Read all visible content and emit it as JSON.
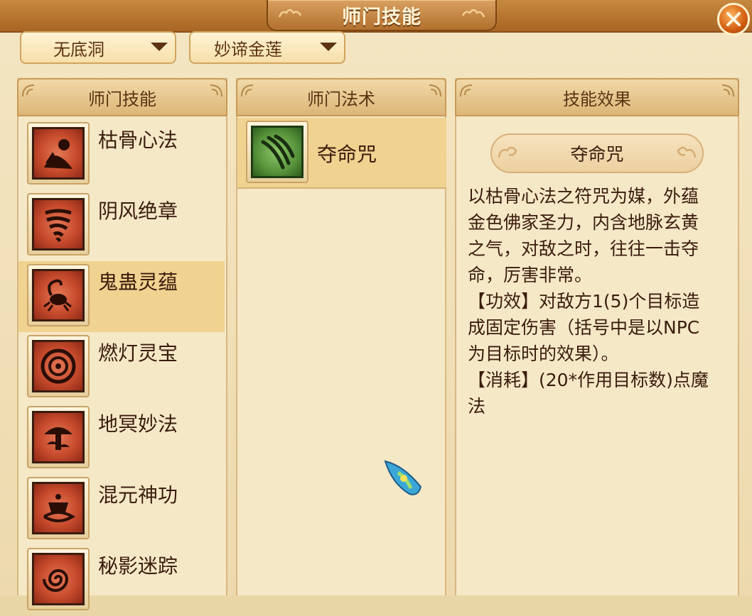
{
  "window": {
    "title": "师门技能",
    "close_icon": "close-x-icon"
  },
  "dropdowns": {
    "sect": "无底洞",
    "school": "妙谛金莲"
  },
  "panels": {
    "skills_header": "师门技能",
    "spells_header": "师门法术",
    "effect_header": "技能效果"
  },
  "skills": [
    {
      "label": "枯骨心法",
      "icon": "skull-flower-icon",
      "selected": false
    },
    {
      "label": "阴风绝章",
      "icon": "whirlwind-icon",
      "selected": false
    },
    {
      "label": "鬼蛊灵蕴",
      "icon": "scorpion-icon",
      "selected": true
    },
    {
      "label": "燃灯灵宝",
      "icon": "coin-disc-icon",
      "selected": false
    },
    {
      "label": "地冥妙法",
      "icon": "mushroom-icon",
      "selected": false
    },
    {
      "label": "混元神功",
      "icon": "cauldron-icon",
      "selected": false
    },
    {
      "label": "秘影迷踪",
      "icon": "spiral-icon",
      "selected": false
    }
  ],
  "spells": [
    {
      "label": "夺命咒",
      "icon": "claw-marks-icon",
      "selected": true
    }
  ],
  "effect": {
    "name": "夺命咒",
    "description": "以枯骨心法之符咒为媒，外蕴\n金色佛家圣力，内含地脉玄黄\n之气，对敌之时，往往一击夺\n命，厉害非常。\n【功效】对敌方1(5)个目标造\n成固定伤害（括号中是以NPC\n为目标时的效果）。\n【消耗】(20*作用目标数)点魔\n法"
  },
  "colors": {
    "frame_brown": "#a86524",
    "panel_bg": "#f5e8c7",
    "selected_row": "#f0d291",
    "text_dark": "#3a1c0c",
    "skill_icon_red": "#c64a2c",
    "spell_icon_green": "#56923a"
  }
}
